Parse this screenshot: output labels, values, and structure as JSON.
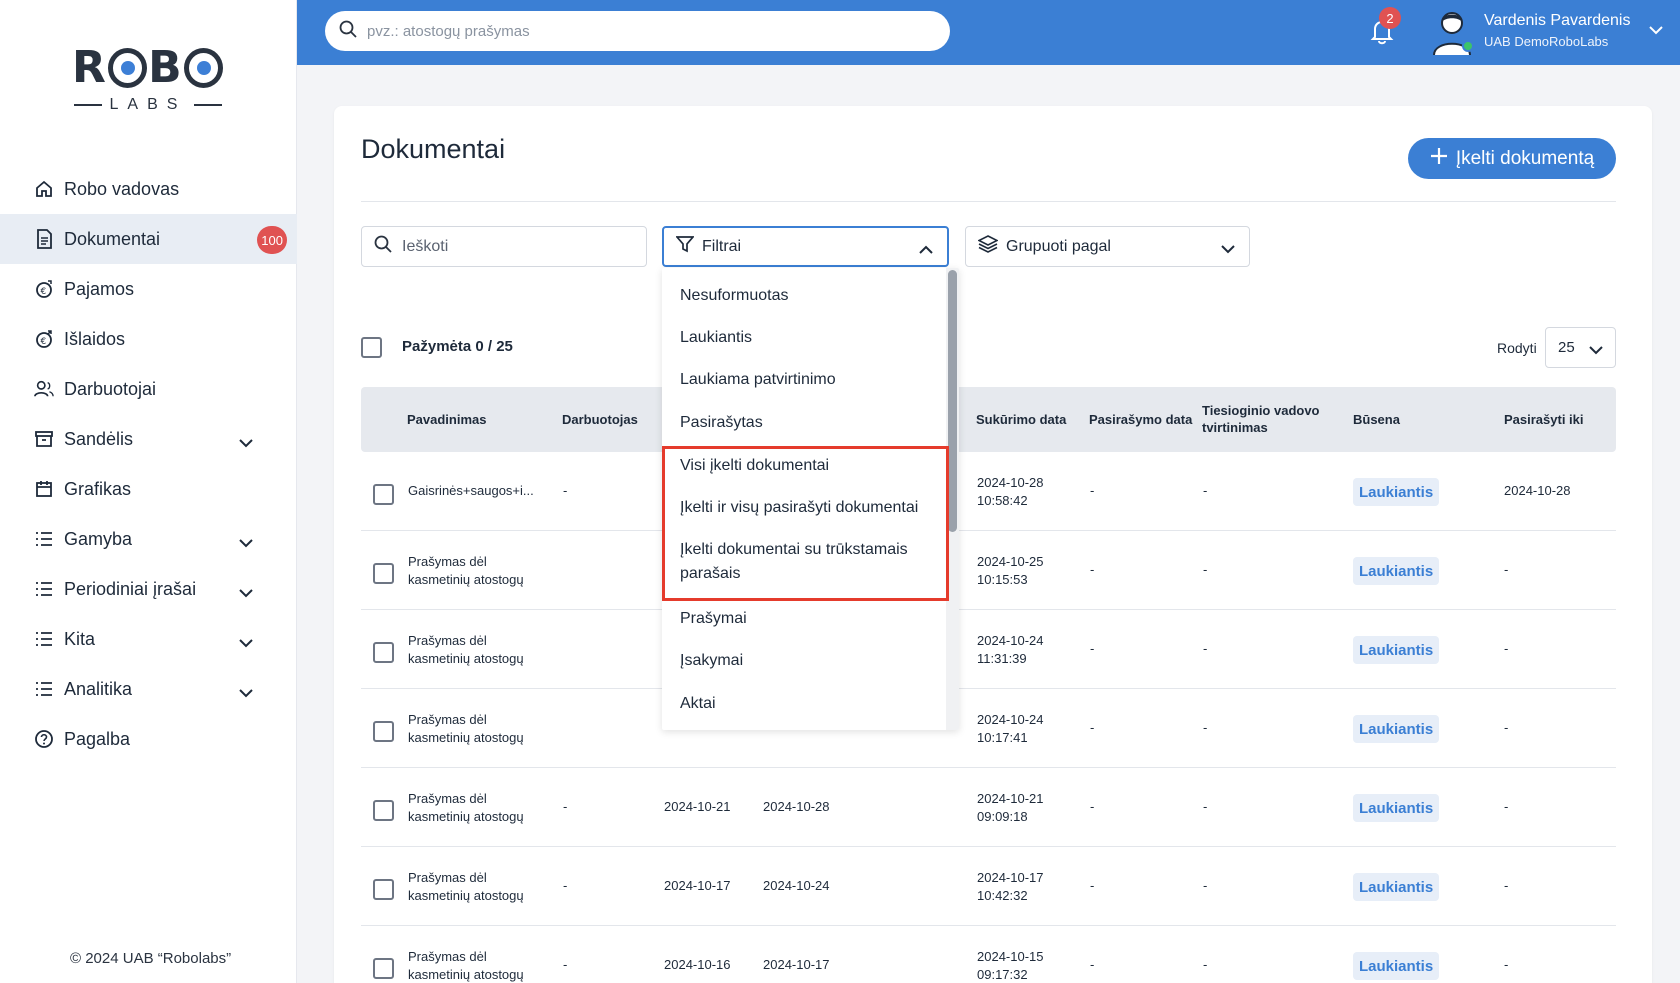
{
  "logo": {
    "top": "RBO",
    "bottom": "LABS"
  },
  "top_search": {
    "placeholder": "pvz.: atostogų prašymas"
  },
  "notifications": {
    "count": "2"
  },
  "user": {
    "name": "Vardenis Pavardenis",
    "company": "UAB DemoRoboLabs"
  },
  "sidebar": {
    "items": [
      {
        "label": "Robo vadovas",
        "icon": "home-icon"
      },
      {
        "label": "Dokumentai",
        "icon": "document-icon",
        "badge": "100"
      },
      {
        "label": "Pajamos",
        "icon": "income-icon"
      },
      {
        "label": "Išlaidos",
        "icon": "expenses-icon"
      },
      {
        "label": "Darbuotojai",
        "icon": "users-icon"
      },
      {
        "label": "Sandėlis",
        "icon": "archive-icon"
      },
      {
        "label": "Grafikas",
        "icon": "calendar-icon"
      },
      {
        "label": "Gamyba",
        "icon": "list-icon"
      },
      {
        "label": "Periodiniai įrašai",
        "icon": "list-icon"
      },
      {
        "label": "Kita",
        "icon": "list-icon"
      },
      {
        "label": "Analitika",
        "icon": "list-icon"
      },
      {
        "label": "Pagalba",
        "icon": "help-icon"
      }
    ],
    "copyright": "© 2024 UAB “Robolabs”"
  },
  "main": {
    "title": "Dokumentai",
    "upload_button": "Įkelti dokumentą",
    "search_placeholder": "Ieškoti",
    "filter_label": "Filtrai",
    "group_label": "Grupuoti pagal",
    "selected_text": "Pažymėta 0 / 25",
    "show_label": "Rodyti",
    "show_value": "25"
  },
  "filter_options": [
    "Nesuformuotas",
    "Laukiantis",
    "Laukiama patvirtinimo",
    "Pasirašytas",
    "Visi įkelti dokumentai",
    "Įkelti ir visų pasirašyti dokumentai",
    "Įkelti dokumentai su trūkstamais parašais",
    "Prašymai",
    "Įsakymai",
    "Aktai"
  ],
  "table": {
    "headers": {
      "name": "Pavadinimas",
      "employee": "Darbuotojas",
      "created": "Sukūrimo data",
      "signed": "Pasirašymo data",
      "manager1": "Tiesioginio vadovo",
      "manager2": "tvirtinimas",
      "status": "Būsena",
      "sign_until": "Pasirašyti iki"
    },
    "rows": [
      {
        "name1": "Gaisrinės+saugos+i...",
        "name2": "",
        "employee": "-",
        "date_a": "",
        "date_b": "",
        "created1": "2024-10-28",
        "created2": "10:58:42",
        "signed": "-",
        "manager": "-",
        "status": "Laukiantis",
        "sign_until": "2024-10-28"
      },
      {
        "name1": "Prašymas dėl",
        "name2": "kasmetinių atostogų",
        "employee": "",
        "date_a": "",
        "date_b": "",
        "created1": "2024-10-25",
        "created2": "10:15:53",
        "signed": "-",
        "manager": "-",
        "status": "Laukiantis",
        "sign_until": "-"
      },
      {
        "name1": "Prašymas dėl",
        "name2": "kasmetinių atostogų",
        "employee": "",
        "date_a": "",
        "date_b": "",
        "created1": "2024-10-24",
        "created2": "11:31:39",
        "signed": "-",
        "manager": "-",
        "status": "Laukiantis",
        "sign_until": "-"
      },
      {
        "name1": "Prašymas dėl",
        "name2": "kasmetinių atostogų",
        "employee": "",
        "date_a": "",
        "date_b": "",
        "created1": "2024-10-24",
        "created2": "10:17:41",
        "signed": "-",
        "manager": "-",
        "status": "Laukiantis",
        "sign_until": "-"
      },
      {
        "name1": "Prašymas dėl",
        "name2": "kasmetinių atostogų",
        "employee": "-",
        "date_a": "2024-10-21",
        "date_b": "2024-10-28",
        "created1": "2024-10-21",
        "created2": "09:09:18",
        "signed": "-",
        "manager": "-",
        "status": "Laukiantis",
        "sign_until": "-"
      },
      {
        "name1": "Prašymas dėl",
        "name2": "kasmetinių atostogų",
        "employee": "-",
        "date_a": "2024-10-17",
        "date_b": "2024-10-24",
        "created1": "2024-10-17",
        "created2": "10:42:32",
        "signed": "-",
        "manager": "-",
        "status": "Laukiantis",
        "sign_until": "-"
      },
      {
        "name1": "Prašymas dėl",
        "name2": "kasmetinių atostogų",
        "employee": "-",
        "date_a": "2024-10-16",
        "date_b": "2024-10-17",
        "created1": "2024-10-15",
        "created2": "09:17:32",
        "signed": "-",
        "manager": "-",
        "status": "Laukiantis",
        "sign_until": "-"
      }
    ]
  },
  "colors": {
    "accent": "#3b7fd4",
    "badge": "#e05252",
    "highlight": "#e53b2c"
  }
}
